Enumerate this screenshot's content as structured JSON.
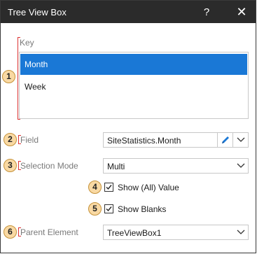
{
  "window": {
    "title": "Tree View Box",
    "help_glyph": "?",
    "close_glyph": "✕"
  },
  "key": {
    "label": "Key",
    "items": [
      {
        "label": "Month",
        "selected": true
      },
      {
        "label": "Week",
        "selected": false
      }
    ]
  },
  "field": {
    "label": "Field",
    "value": "SiteStatistics.Month"
  },
  "selection_mode": {
    "label": "Selection Mode",
    "value": "Multi"
  },
  "show_all": {
    "label": "Show (All) Value",
    "checked": true
  },
  "show_blanks": {
    "label": "Show Blanks",
    "checked": true
  },
  "parent_element": {
    "label": "Parent Element",
    "value": "TreeViewBox1"
  },
  "badges": [
    "1",
    "2",
    "3",
    "4",
    "5",
    "6"
  ],
  "colors": {
    "titlebar": "#2b2b2b",
    "selection": "#1a78d6",
    "badge_fill": "#f9d9a3",
    "badge_border": "#c5923a",
    "bracket": "#dd3333"
  }
}
